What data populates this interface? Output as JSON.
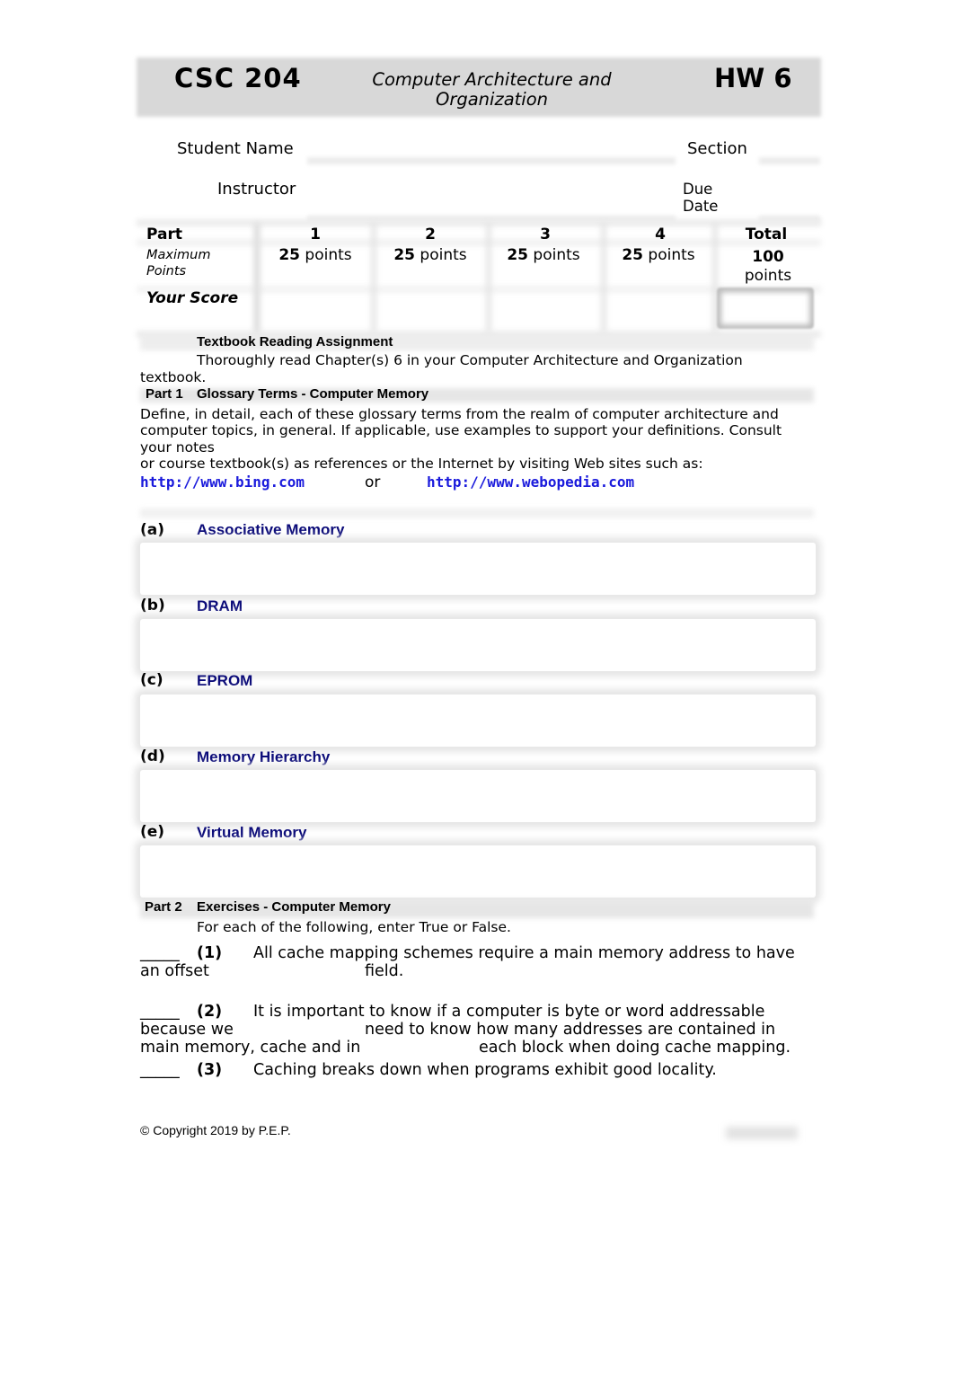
{
  "header": {
    "course": "CSC 204",
    "title": "Computer Architecture and Organization",
    "assignment": "HW 6"
  },
  "fields": {
    "student_name_label": "Student Name",
    "section_label": "Section",
    "instructor_label": "Instructor",
    "due_date_label": "Due Date",
    "student_name_value": "",
    "section_value": "",
    "instructor_value": "",
    "due_date_value": ""
  },
  "score_table": {
    "row_labels": {
      "part": "Part",
      "max_points": "Maximum Points",
      "your_score": "Your Score"
    },
    "columns": [
      {
        "part": "1",
        "max_value": "25",
        "max_unit": "points",
        "score": ""
      },
      {
        "part": "2",
        "max_value": "25",
        "max_unit": "points",
        "score": ""
      },
      {
        "part": "3",
        "max_value": "25",
        "max_unit": "points",
        "score": ""
      },
      {
        "part": "4",
        "max_value": "25",
        "max_unit": "points",
        "score": ""
      },
      {
        "part": "Total",
        "max_value": "100",
        "max_unit": "points",
        "score": ""
      }
    ]
  },
  "reading": {
    "heading": "Textbook Reading Assignment",
    "line1": "Thoroughly read Chapter(s) 6 in your Computer Architecture and Organization",
    "line2": "textbook."
  },
  "part1": {
    "label": "Part 1",
    "title": "Glossary Terms - Computer Memory",
    "instructions": [
      "Define, in detail, each of these glossary terms from the realm of computer architecture and",
      "computer topics, in general.  If applicable, use examples to support your definitions.  Consult",
      "your notes",
      "or course textbook(s) as references or the Internet by visiting Web sites such as:"
    ],
    "link1": "http://www.bing.com",
    "or_text": "or",
    "link2": "http://www.webopedia.com",
    "terms": [
      {
        "letter": "(a)",
        "name": "Associative Memory",
        "answer": ""
      },
      {
        "letter": "(b)",
        "name": "DRAM",
        "answer": ""
      },
      {
        "letter": "(c)",
        "name": "EPROM",
        "answer": ""
      },
      {
        "letter": "(d)",
        "name": "Memory Hierarchy",
        "answer": ""
      },
      {
        "letter": "(e)",
        "name": "Virtual Memory",
        "answer": ""
      }
    ]
  },
  "part2": {
    "label": "Part 2",
    "title": "Exercises - Computer Memory",
    "instructions": "For each of the following, enter True or False.",
    "blank": "_____",
    "exercises": [
      {
        "num": "(1)",
        "lines": [
          "All cache mapping schemes require a main memory address to have",
          "an offset",
          "field."
        ]
      },
      {
        "num": "(2)",
        "lines": [
          "It is important to know if a computer is byte or word addressable",
          "because we",
          "need to know how many addresses are contained in",
          "main memory, cache and in",
          "each block when doing cache mapping."
        ]
      },
      {
        "num": "(3)",
        "lines": [
          "Caching breaks down when programs exhibit good locality."
        ]
      }
    ]
  },
  "footer": {
    "copyright": "© Copyright 2019 by P.E.P."
  }
}
